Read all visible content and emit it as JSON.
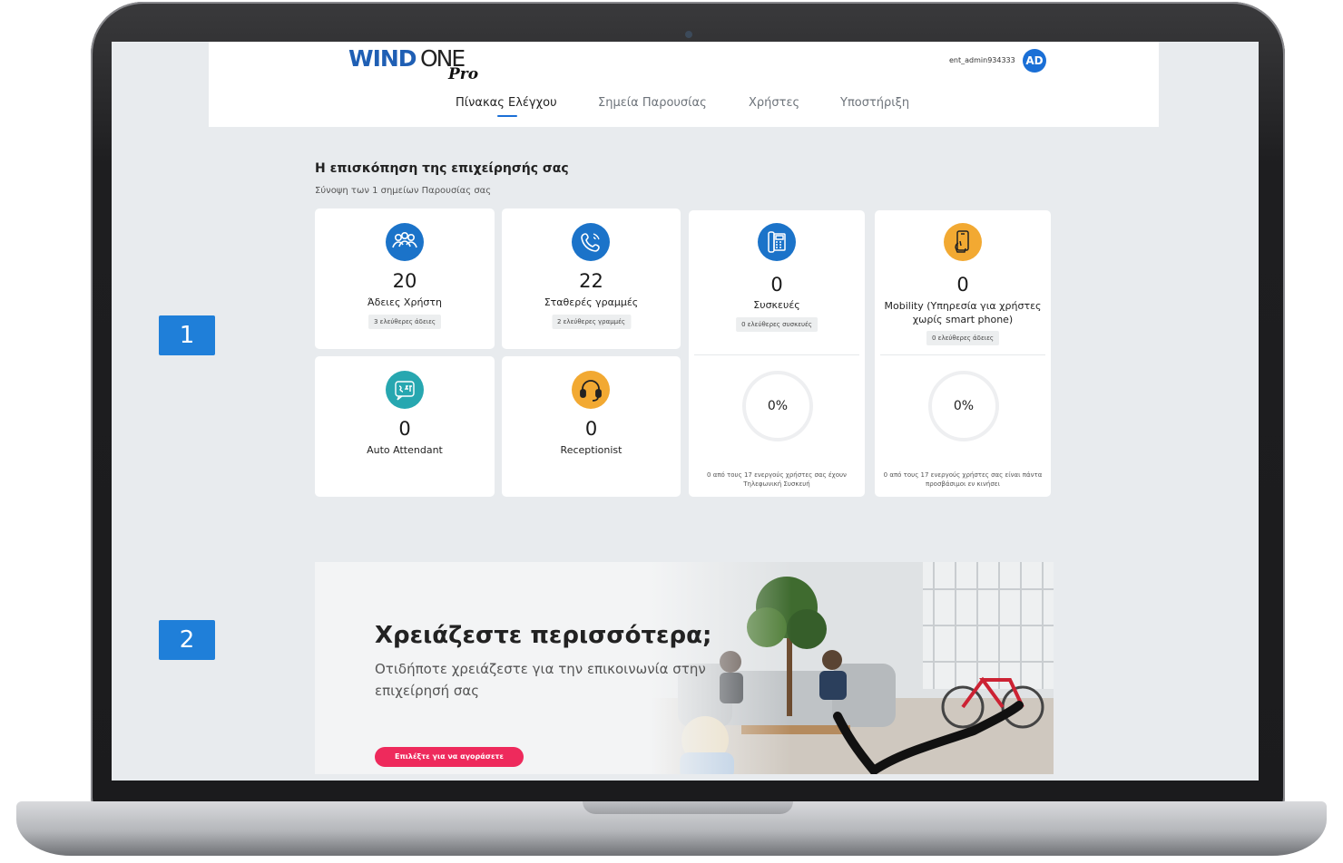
{
  "header": {
    "logo": {
      "wind": "WIND",
      "one": "ONE",
      "pro": "Pro"
    },
    "user_name": "ent_admin934333",
    "avatar_initials": "AD",
    "nav": [
      {
        "label": "Πίνακας Ελέγχου",
        "active": true
      },
      {
        "label": "Σημεία Παρουσίας",
        "active": false
      },
      {
        "label": "Χρήστες",
        "active": false
      },
      {
        "label": "Υποστήριξη",
        "active": false
      }
    ]
  },
  "overview": {
    "title": "Η επισκόπηση της επιχείρησής σας",
    "subtitle": "Σύνοψη των 1 σημείων Παρουσίας σας",
    "cards": {
      "licenses": {
        "value": "20",
        "label": "Άδειες Χρήστη",
        "pill": "3 ελεύθερες άδειες",
        "icon": "users-icon"
      },
      "lines": {
        "value": "22",
        "label": "Σταθερές γραμμές",
        "pill": "2 ελεύθερες γραμμές",
        "icon": "phone-icon"
      },
      "devices": {
        "value": "0",
        "label": "Συσκευές",
        "pill": "0 ελεύθερες συσκευές",
        "icon": "desk-phone-icon",
        "percent": "0%",
        "footnote": "0 από τους 17 ενεργούς χρήστες σας έχουν Τηλεφωνική Συσκευή"
      },
      "mobility": {
        "value": "0",
        "label": "Mobility (Υπηρεσία για χρήστες χωρίς smart phone)",
        "pill": "0 ελεύθερες άδειες",
        "icon": "mobile-phone-icon",
        "percent": "0%",
        "footnote": "0 από τους 17 ενεργούς χρήστες σας είναι πάντα προσβάσιμοι εν κινήσει"
      },
      "auto_attendant": {
        "value": "0",
        "label": "Auto Attendant",
        "icon": "auto-attendant-icon"
      },
      "receptionist": {
        "value": "0",
        "label": "Receptionist",
        "icon": "headset-icon"
      }
    }
  },
  "banner": {
    "title": "Χρειάζεστε περισσότερα;",
    "subtitle": "Οτιδήποτε χρειάζεστε για την επικοινωνία στην επιχείρησή σας",
    "button_label": "Επιλέξτε για να αγοράσετε"
  },
  "steps": [
    "1",
    "2"
  ],
  "colors": {
    "primary": "#1b73c9",
    "teal": "#27a7b0",
    "amber": "#f2a932",
    "cta": "#ee2a5c",
    "page_bg": "#e8ebee"
  }
}
